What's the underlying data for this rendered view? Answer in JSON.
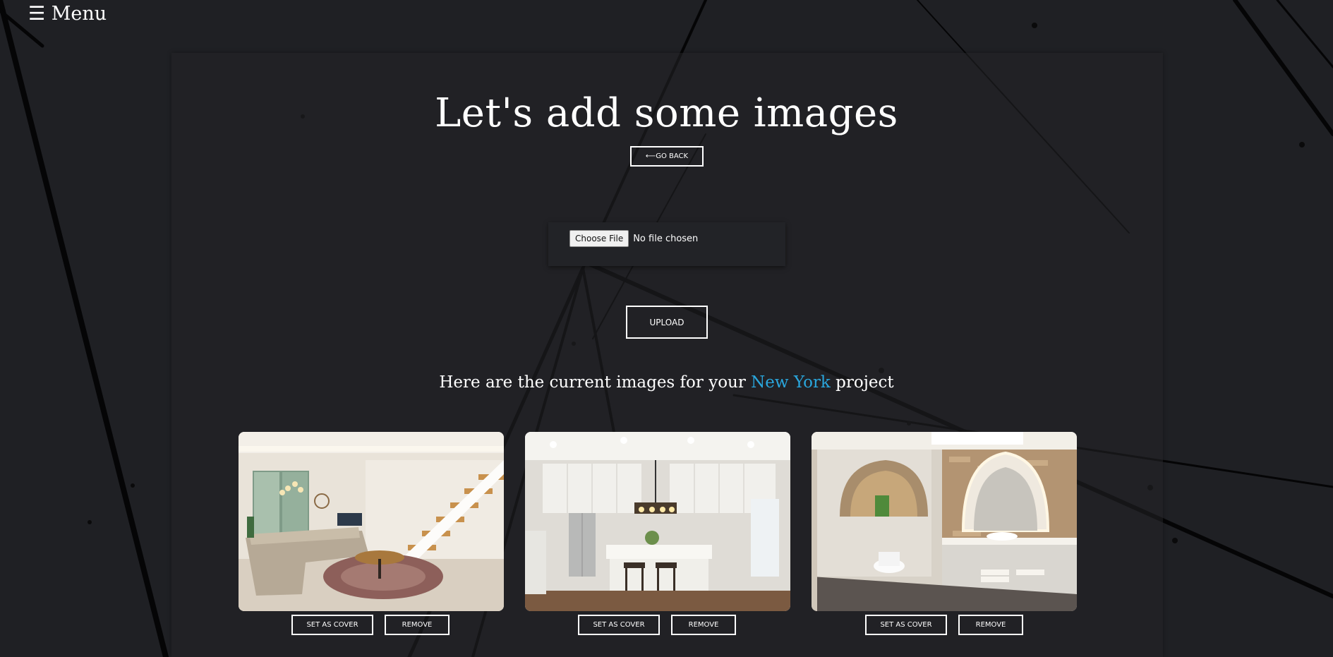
{
  "menu": {
    "icon": "hamburger-icon",
    "label": "☰ Menu"
  },
  "page": {
    "title": "Let's add some images",
    "go_back_label": "⟵GO BACK"
  },
  "upload": {
    "choose_file_label": "Choose File",
    "no_file_text": "No file chosen",
    "upload_label": "UPLOAD"
  },
  "gallery": {
    "heading_prefix": "Here are the current images for your ",
    "project_name": "New York",
    "heading_suffix": " project",
    "accent_color": "#2aa6dc",
    "images": [
      {
        "subject": "living-room-with-staircase",
        "set_cover_label": "SET AS COVER",
        "remove_label": "REMOVE"
      },
      {
        "subject": "white-kitchen-with-island",
        "set_cover_label": "SET AS COVER",
        "remove_label": "REMOVE"
      },
      {
        "subject": "bathroom-with-arched-mirror",
        "set_cover_label": "SET AS COVER",
        "remove_label": "REMOVE"
      }
    ]
  }
}
